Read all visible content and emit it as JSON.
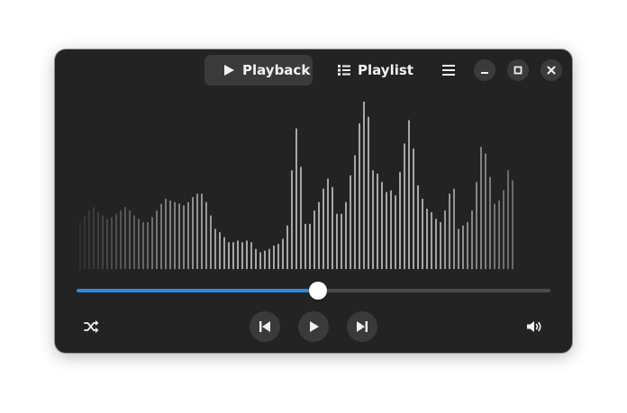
{
  "window": {
    "tabs": [
      {
        "label": "Playback",
        "icon": "play-icon",
        "active": true
      },
      {
        "label": "Playlist",
        "icon": "list-icon",
        "active": false
      }
    ],
    "controls": [
      "menu-icon",
      "minimize-icon",
      "maximize-icon",
      "close-icon"
    ]
  },
  "player": {
    "progress": 0.51,
    "accent_color": "#3584e4",
    "transport": [
      "shuffle-icon",
      "skip-back-icon",
      "play-icon",
      "skip-forward-icon",
      "volume-icon"
    ]
  },
  "visualizer": {
    "bar_count": 97,
    "levels": [
      0.28,
      0.32,
      0.35,
      0.37,
      0.34,
      0.32,
      0.3,
      0.31,
      0.33,
      0.35,
      0.37,
      0.35,
      0.32,
      0.3,
      0.28,
      0.28,
      0.31,
      0.35,
      0.39,
      0.42,
      0.41,
      0.4,
      0.39,
      0.38,
      0.4,
      0.43,
      0.45,
      0.45,
      0.4,
      0.32,
      0.24,
      0.22,
      0.19,
      0.16,
      0.16,
      0.17,
      0.16,
      0.17,
      0.16,
      0.12,
      0.1,
      0.11,
      0.12,
      0.14,
      0.15,
      0.18,
      0.26,
      0.59,
      0.84,
      0.61,
      0.27,
      0.27,
      0.35,
      0.4,
      0.48,
      0.54,
      0.49,
      0.33,
      0.33,
      0.4,
      0.56,
      0.68,
      0.87,
      1.0,
      0.91,
      0.59,
      0.57,
      0.52,
      0.46,
      0.47,
      0.44,
      0.58,
      0.75,
      0.89,
      0.72,
      0.5,
      0.42,
      0.36,
      0.34,
      0.3,
      0.28,
      0.35,
      0.45,
      0.48,
      0.24,
      0.26,
      0.28,
      0.35,
      0.52,
      0.73,
      0.69,
      0.55,
      0.39,
      0.41,
      0.47,
      0.59,
      0.53
    ]
  }
}
